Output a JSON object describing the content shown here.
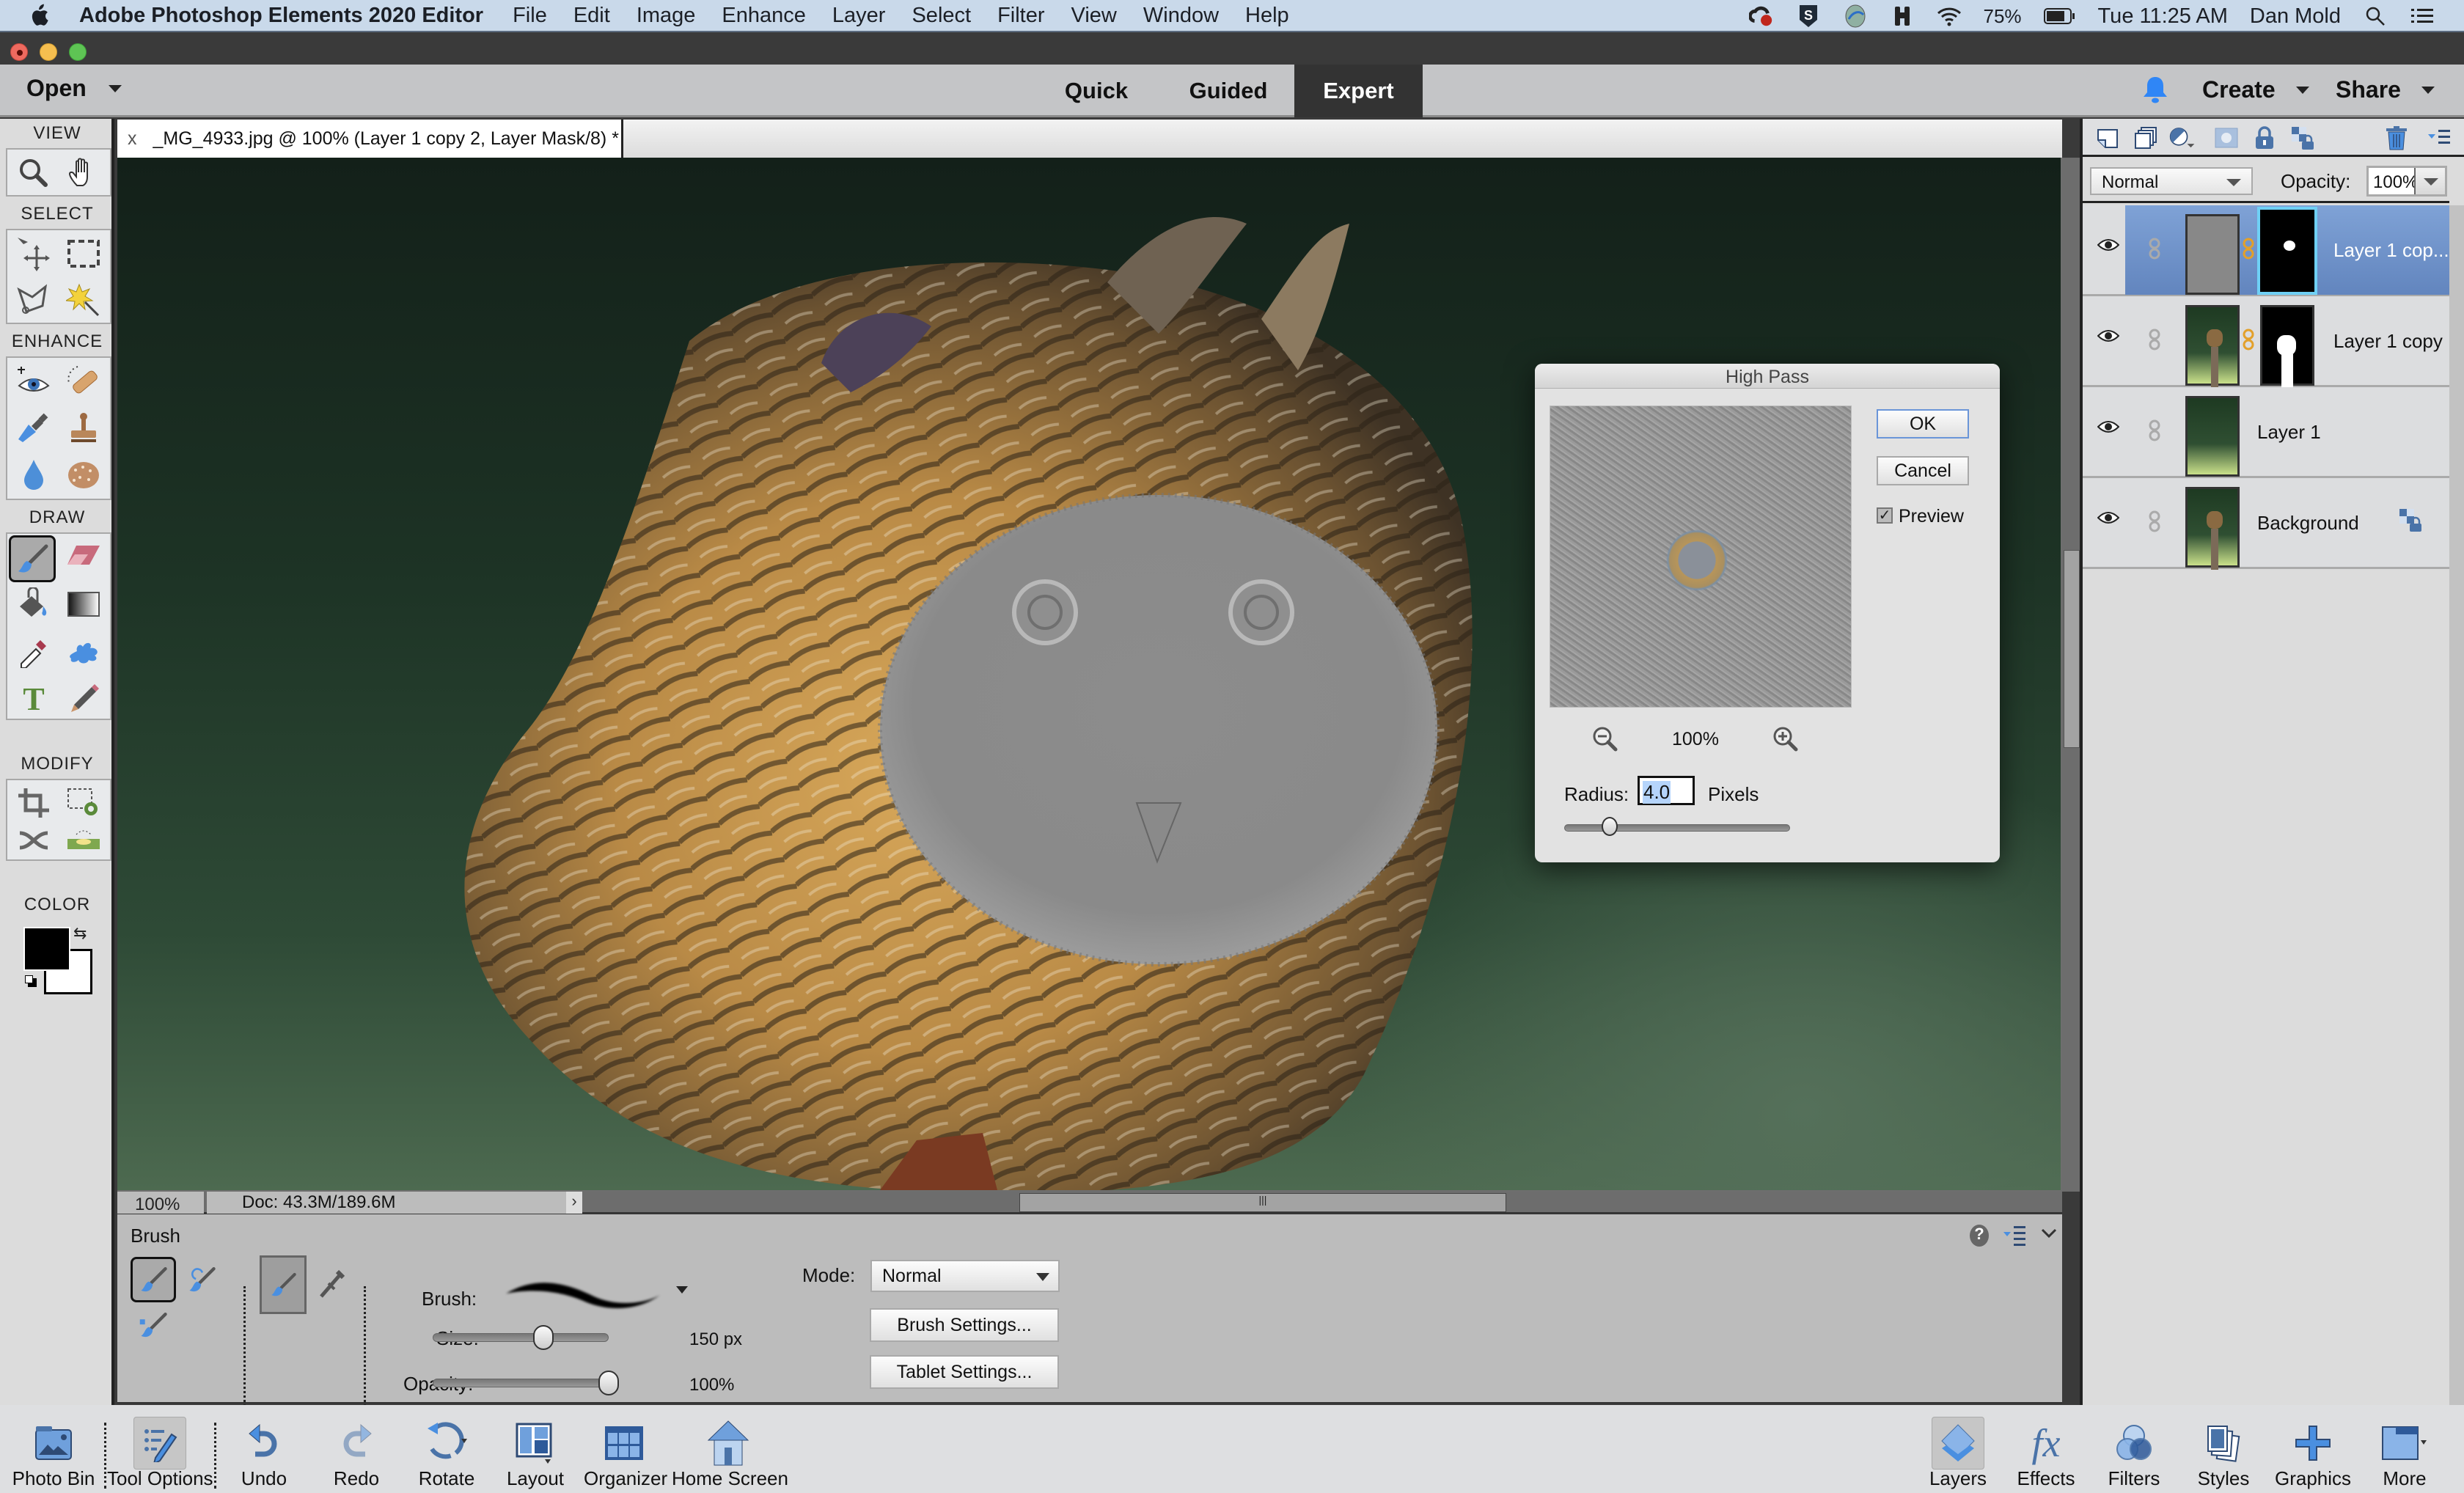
{
  "menubar": {
    "app_name": "Adobe Photoshop Elements 2020 Editor",
    "menus": [
      "File",
      "Edit",
      "Image",
      "Enhance",
      "Layer",
      "Select",
      "Filter",
      "View",
      "Window",
      "Help"
    ],
    "status_icons": [
      "creative-cloud-icon",
      "sophos-shield-icon",
      "vpn-globe-icon",
      "binoculars-icon",
      "wifi-icon"
    ],
    "battery": "75%",
    "clock": "Tue 11:25 AM",
    "user": "Dan Mold"
  },
  "topbar": {
    "open_label": "Open",
    "modes": [
      {
        "label": "Quick",
        "active": false
      },
      {
        "label": "Guided",
        "active": false
      },
      {
        "label": "Expert",
        "active": true
      }
    ],
    "create_label": "Create",
    "share_label": "Share",
    "accent": "#2f86f6"
  },
  "toolbox": {
    "sections": {
      "view": "VIEW",
      "select": "SELECT",
      "enhance": "ENHANCE",
      "draw": "DRAW",
      "modify": "MODIFY",
      "color": "COLOR"
    },
    "selected_tool": "brush",
    "foreground_color": "#000000",
    "background_color": "#ffffff"
  },
  "document": {
    "tab_close": "x",
    "tab_title": "_MG_4933.jpg @ 100% (Layer 1 copy 2, Layer Mask/8) *",
    "zoom": "100%",
    "doc_info": "Doc: 43.3M/189.6M",
    "doc_info_arrow": "›"
  },
  "dialog": {
    "title": "High Pass",
    "ok_label": "OK",
    "cancel_label": "Cancel",
    "preview_label": "Preview",
    "preview_checked": true,
    "zoom_level": "100%",
    "radius_label": "Radius:",
    "radius_value": "4.0",
    "radius_unit": "Pixels",
    "radius_slider_fraction": 0.2
  },
  "tool_options": {
    "tool_name": "Brush",
    "brush_label": "Brush:",
    "size_label": "Size:",
    "size_value": "150 px",
    "size_fraction": 0.63,
    "opacity_label": "Opacity:",
    "opacity_value": "100%",
    "opacity_fraction": 1.0,
    "mode_label": "Mode:",
    "mode_value": "Normal",
    "brush_settings_label": "Brush Settings...",
    "tablet_settings_label": "Tablet Settings..."
  },
  "layers_panel": {
    "blend_mode": "Normal",
    "opacity_label": "Opacity:",
    "opacity_value": "100%",
    "layers": [
      {
        "name": "Layer 1 cop...",
        "selected": true,
        "has_mask": true,
        "thumb": "gray"
      },
      {
        "name": "Layer 1 copy",
        "selected": false,
        "has_mask": true,
        "thumb": "owl"
      },
      {
        "name": "Layer 1",
        "selected": false,
        "has_mask": false,
        "thumb": "bg"
      },
      {
        "name": "Background",
        "selected": false,
        "has_mask": false,
        "thumb": "owl",
        "locked": true
      }
    ],
    "selection_color": "#6f93cb"
  },
  "bottom_bar": {
    "left": [
      {
        "label": "Photo Bin",
        "icon": "photo-bin-icon"
      },
      {
        "label": "Tool Options",
        "icon": "tool-options-icon",
        "selected": true
      },
      {
        "label": "Undo",
        "icon": "undo-icon"
      },
      {
        "label": "Redo",
        "icon": "redo-icon"
      },
      {
        "label": "Rotate",
        "icon": "rotate-icon"
      },
      {
        "label": "Layout",
        "icon": "layout-icon"
      },
      {
        "label": "Organizer",
        "icon": "organizer-icon"
      },
      {
        "label": "Home Screen",
        "icon": "home-icon"
      }
    ],
    "right": [
      {
        "label": "Layers",
        "icon": "layers-icon",
        "selected": true
      },
      {
        "label": "Effects",
        "icon": "effects-fx-icon"
      },
      {
        "label": "Filters",
        "icon": "filters-icon"
      },
      {
        "label": "Styles",
        "icon": "styles-icon"
      },
      {
        "label": "Graphics",
        "icon": "graphics-icon"
      },
      {
        "label": "More",
        "icon": "more-icon"
      }
    ]
  }
}
